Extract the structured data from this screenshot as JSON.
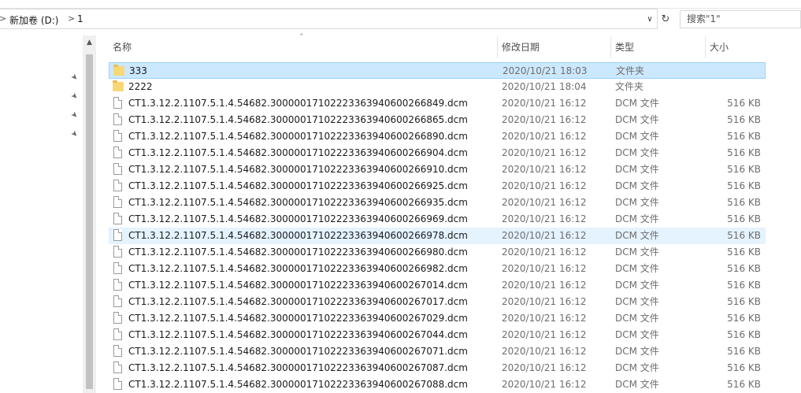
{
  "address": {
    "crumbs": [
      "新加卷 (D:)",
      "1"
    ]
  },
  "search": {
    "placeholder": "搜索\"1\""
  },
  "columns": {
    "name": "名称",
    "date": "修改日期",
    "type": "类型",
    "size": "大小"
  },
  "files": [
    {
      "name": "333",
      "date": "2020/10/21 18:03",
      "type": "文件夹",
      "size": "",
      "kind": "folder",
      "state": "selected"
    },
    {
      "name": "2222",
      "date": "2020/10/21 18:04",
      "type": "文件夹",
      "size": "",
      "kind": "folder",
      "state": ""
    },
    {
      "name": "CT1.3.12.2.1107.5.1.4.54682.30000017102223363940600266849.dcm",
      "date": "2020/10/21 16:12",
      "type": "DCM 文件",
      "size": "516 KB",
      "kind": "file",
      "state": ""
    },
    {
      "name": "CT1.3.12.2.1107.5.1.4.54682.30000017102223363940600266865.dcm",
      "date": "2020/10/21 16:12",
      "type": "DCM 文件",
      "size": "516 KB",
      "kind": "file",
      "state": ""
    },
    {
      "name": "CT1.3.12.2.1107.5.1.4.54682.30000017102223363940600266890.dcm",
      "date": "2020/10/21 16:12",
      "type": "DCM 文件",
      "size": "516 KB",
      "kind": "file",
      "state": ""
    },
    {
      "name": "CT1.3.12.2.1107.5.1.4.54682.30000017102223363940600266904.dcm",
      "date": "2020/10/21 16:12",
      "type": "DCM 文件",
      "size": "516 KB",
      "kind": "file",
      "state": ""
    },
    {
      "name": "CT1.3.12.2.1107.5.1.4.54682.30000017102223363940600266910.dcm",
      "date": "2020/10/21 16:12",
      "type": "DCM 文件",
      "size": "516 KB",
      "kind": "file",
      "state": ""
    },
    {
      "name": "CT1.3.12.2.1107.5.1.4.54682.30000017102223363940600266925.dcm",
      "date": "2020/10/21 16:12",
      "type": "DCM 文件",
      "size": "516 KB",
      "kind": "file",
      "state": ""
    },
    {
      "name": "CT1.3.12.2.1107.5.1.4.54682.30000017102223363940600266935.dcm",
      "date": "2020/10/21 16:12",
      "type": "DCM 文件",
      "size": "516 KB",
      "kind": "file",
      "state": ""
    },
    {
      "name": "CT1.3.12.2.1107.5.1.4.54682.30000017102223363940600266969.dcm",
      "date": "2020/10/21 16:12",
      "type": "DCM 文件",
      "size": "516 KB",
      "kind": "file",
      "state": ""
    },
    {
      "name": "CT1.3.12.2.1107.5.1.4.54682.30000017102223363940600266978.dcm",
      "date": "2020/10/21 16:12",
      "type": "DCM 文件",
      "size": "516 KB",
      "kind": "file",
      "state": "hover"
    },
    {
      "name": "CT1.3.12.2.1107.5.1.4.54682.30000017102223363940600266980.dcm",
      "date": "2020/10/21 16:12",
      "type": "DCM 文件",
      "size": "516 KB",
      "kind": "file",
      "state": ""
    },
    {
      "name": "CT1.3.12.2.1107.5.1.4.54682.30000017102223363940600266982.dcm",
      "date": "2020/10/21 16:12",
      "type": "DCM 文件",
      "size": "516 KB",
      "kind": "file",
      "state": ""
    },
    {
      "name": "CT1.3.12.2.1107.5.1.4.54682.30000017102223363940600267014.dcm",
      "date": "2020/10/21 16:12",
      "type": "DCM 文件",
      "size": "516 KB",
      "kind": "file",
      "state": ""
    },
    {
      "name": "CT1.3.12.2.1107.5.1.4.54682.30000017102223363940600267017.dcm",
      "date": "2020/10/21 16:12",
      "type": "DCM 文件",
      "size": "516 KB",
      "kind": "file",
      "state": ""
    },
    {
      "name": "CT1.3.12.2.1107.5.1.4.54682.30000017102223363940600267029.dcm",
      "date": "2020/10/21 16:12",
      "type": "DCM 文件",
      "size": "516 KB",
      "kind": "file",
      "state": ""
    },
    {
      "name": "CT1.3.12.2.1107.5.1.4.54682.30000017102223363940600267044.dcm",
      "date": "2020/10/21 16:12",
      "type": "DCM 文件",
      "size": "516 KB",
      "kind": "file",
      "state": ""
    },
    {
      "name": "CT1.3.12.2.1107.5.1.4.54682.30000017102223363940600267071.dcm",
      "date": "2020/10/21 16:12",
      "type": "DCM 文件",
      "size": "516 KB",
      "kind": "file",
      "state": ""
    },
    {
      "name": "CT1.3.12.2.1107.5.1.4.54682.30000017102223363940600267087.dcm",
      "date": "2020/10/21 16:12",
      "type": "DCM 文件",
      "size": "516 KB",
      "kind": "file",
      "state": ""
    },
    {
      "name": "CT1.3.12.2.1107.5.1.4.54682.30000017102223363940600267088.dcm",
      "date": "2020/10/21 16:12",
      "type": "DCM 文件",
      "size": "516 KB",
      "kind": "file",
      "state": ""
    }
  ],
  "colors": {
    "selected_bg": "#cce8ff",
    "selected_border": "#99d1ff",
    "hover_bg": "#e5f3ff",
    "folder": "#f8d775"
  },
  "icons": {
    "pin": "pin-icon",
    "folder": "folder-icon",
    "file": "file-icon",
    "refresh": "refresh-icon",
    "dropdown": "chevron-down-icon"
  }
}
